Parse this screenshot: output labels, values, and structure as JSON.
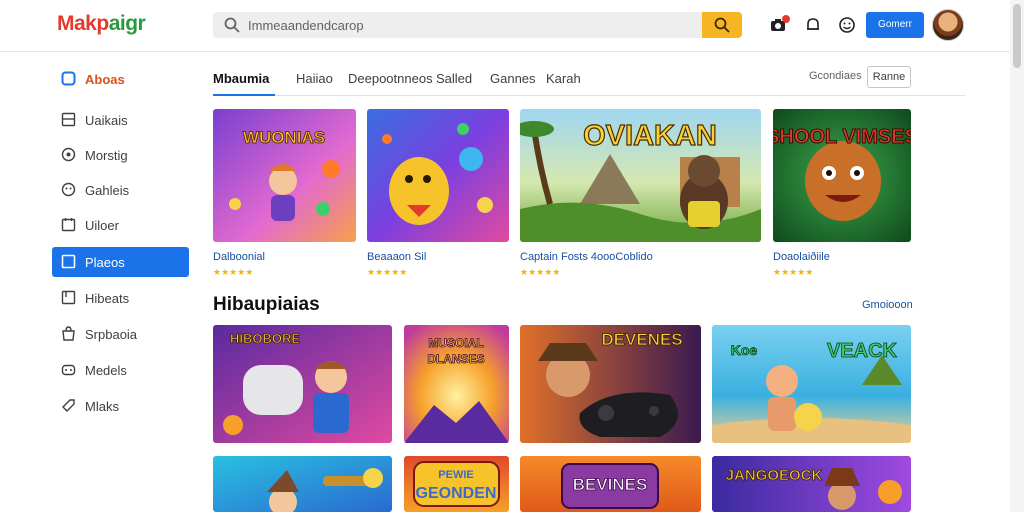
{
  "header": {
    "logo_part1": "Makp",
    "logo_part2": "aigr",
    "search_placeholder": "Immeaandendcarop",
    "signin_label": "Gomerr"
  },
  "sidebar": {
    "items": [
      {
        "label": "Aboas",
        "icon": "home-icon"
      },
      {
        "label": "Uaikais",
        "icon": "library-icon"
      },
      {
        "label": "Morstig",
        "icon": "target-icon"
      },
      {
        "label": "Gahleis",
        "icon": "gamepad-icon"
      },
      {
        "label": "Uiloer",
        "icon": "calendar-icon"
      },
      {
        "label": "Plaeos",
        "icon": "square-icon"
      },
      {
        "label": "Hibeats",
        "icon": "bookmark-icon"
      },
      {
        "label": "Srpbaoia",
        "icon": "bag-icon"
      },
      {
        "label": "Medels",
        "icon": "controller-icon"
      },
      {
        "label": "Mlaks",
        "icon": "tag-icon"
      }
    ]
  },
  "tabs": {
    "items": [
      "Mbaumia",
      "Haiiao",
      "Deepootnneos",
      "Salled",
      "Gannes",
      "Karah"
    ],
    "sort_label": "Gcondiaes",
    "sort_button": "Ranne"
  },
  "featured": [
    {
      "title": "Dalboonial",
      "art_text": "WUONIAS",
      "rating": "★★★★★"
    },
    {
      "title": "Beaaaon Sil",
      "art_text": "",
      "rating": "★★★★★"
    },
    {
      "title": "Captain Fosts 4oooCoblido",
      "art_text": "OVIAKAN",
      "rating": "★★★★★"
    },
    {
      "title": "Doaolaiðiile",
      "art_text": "SHOOL VIMSES",
      "rating": "★★★★★"
    }
  ],
  "section": {
    "title": "Hibaupiaias",
    "see_all": "Gmoiooon"
  },
  "grid": [
    {
      "art_text": "HIBOBORE"
    },
    {
      "art_text": "MUSOIAL DLANSES"
    },
    {
      "art_text": "DEVENES"
    },
    {
      "art_text": "VEACK"
    },
    {
      "art_text": ""
    },
    {
      "art_text": "PEWIE GEONDEN"
    },
    {
      "art_text": "BEVINES"
    },
    {
      "art_text": "JANGOEOCK"
    }
  ],
  "colors": {
    "accent": "#1a73e8",
    "search_button": "#f7b524",
    "home_label": "#d9511c",
    "star": "#f4b400",
    "link": "#1a4fa0"
  }
}
